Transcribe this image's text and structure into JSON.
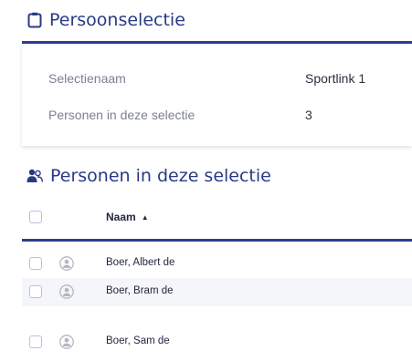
{
  "selection_section": {
    "title": "Persoonselectie",
    "icon": "clipboard-icon",
    "fields": [
      {
        "label": "Selectienaam",
        "value": "Sportlink 1"
      },
      {
        "label": "Personen in deze selectie",
        "value": "3"
      }
    ]
  },
  "persons_section": {
    "title": "Personen in deze selectie",
    "icon": "users-icon",
    "table": {
      "name_header": "Naam",
      "sort_indicator": "▲",
      "rows": [
        {
          "name": "Boer, Albert de",
          "avatar": "user-circle-icon"
        },
        {
          "name": "Boer, Bram de",
          "avatar": "user-circle-icon"
        },
        {
          "name": "Boer, Sam de",
          "avatar": "user-circle-icon"
        }
      ]
    }
  },
  "colors": {
    "accent": "#2e3e8f",
    "title": "#283a86",
    "alt_row": "#f4f6f9"
  }
}
